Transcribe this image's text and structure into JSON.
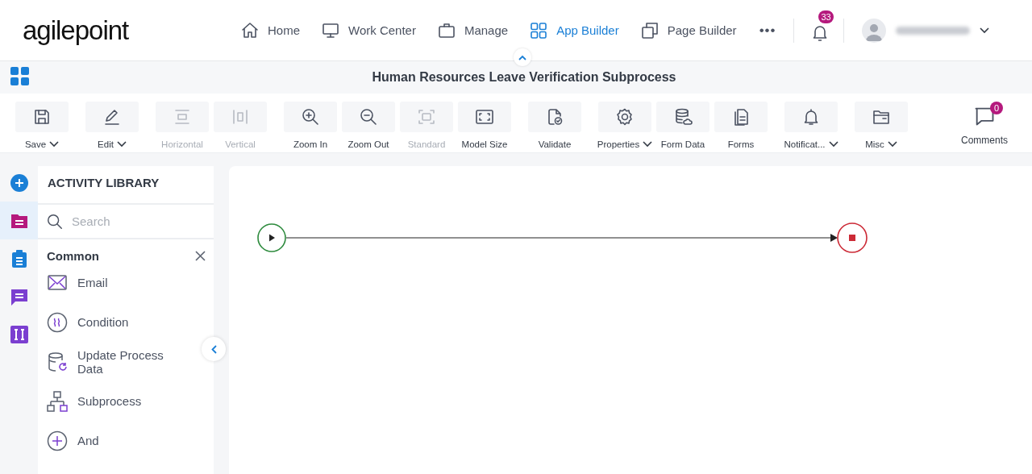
{
  "header": {
    "logo": "agilepoint",
    "nav": [
      {
        "label": "Home",
        "selected": false
      },
      {
        "label": "Work Center",
        "selected": false
      },
      {
        "label": "Manage",
        "selected": false
      },
      {
        "label": "App Builder",
        "selected": true
      },
      {
        "label": "Page Builder",
        "selected": false
      }
    ],
    "more": "•••",
    "notifications": "33"
  },
  "title": "Human Resources Leave Verification Subprocess",
  "toolbar": {
    "groups": [
      [
        {
          "label": "Save",
          "menu": true,
          "disabled": false
        }
      ],
      [
        {
          "label": "Edit",
          "menu": true,
          "disabled": false
        }
      ],
      [
        {
          "label": "Horizontal",
          "menu": false,
          "disabled": true
        },
        {
          "label": "Vertical",
          "menu": false,
          "disabled": true
        }
      ],
      [
        {
          "label": "Zoom In",
          "menu": false,
          "disabled": false
        },
        {
          "label": "Zoom Out",
          "menu": false,
          "disabled": false
        },
        {
          "label": "Standard",
          "menu": false,
          "disabled": true
        },
        {
          "label": "Model Size",
          "menu": false,
          "disabled": false
        }
      ],
      [
        {
          "label": "Validate",
          "menu": false,
          "disabled": false
        }
      ],
      [
        {
          "label": "Properties",
          "menu": true,
          "disabled": false
        },
        {
          "label": "Form Data",
          "menu": false,
          "disabled": false
        },
        {
          "label": "Forms",
          "menu": false,
          "disabled": false
        }
      ],
      [
        {
          "label": "Notificat...",
          "menu": true,
          "disabled": false
        }
      ],
      [
        {
          "label": "Misc",
          "menu": true,
          "disabled": false
        }
      ]
    ],
    "comments": {
      "label": "Comments",
      "count": "0"
    }
  },
  "rail": [
    {
      "selected": false
    },
    {
      "selected": true
    },
    {
      "selected": false
    },
    {
      "selected": false
    },
    {
      "selected": false
    }
  ],
  "library": {
    "title": "ACTIVITY LIBRARY",
    "search": {
      "placeholder": "Search"
    },
    "category": "Common",
    "items": [
      "Email",
      "Condition",
      "Update Process Data",
      "Subprocess",
      "And"
    ]
  }
}
